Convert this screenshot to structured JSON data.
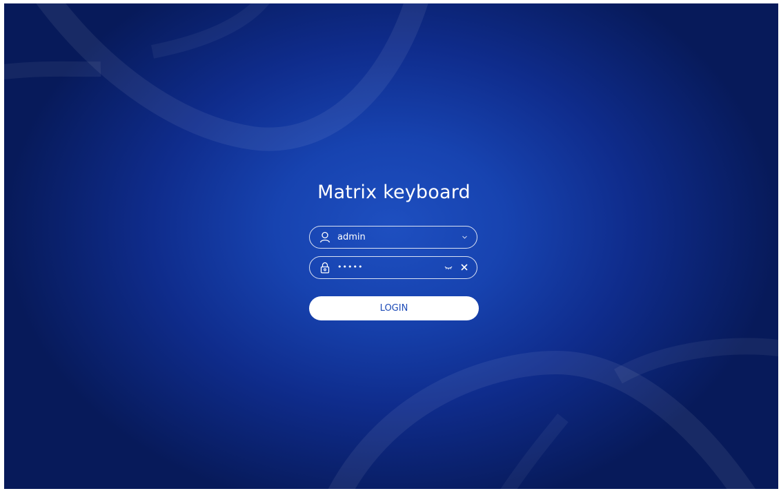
{
  "app": {
    "title": "Matrix keyboard"
  },
  "login": {
    "username": {
      "value": "admin",
      "icon": "user-icon",
      "trailing_icon": "chevron-down-icon"
    },
    "password": {
      "value": "•••••",
      "icon": "lock-icon",
      "trailing_icons": [
        "eye-closed-icon",
        "clear-icon"
      ]
    },
    "button_label": "LOGIN"
  },
  "colors": {
    "background_center": "#1e4fc0",
    "background_edge": "#071a5a",
    "foreground": "#ffffff",
    "button_text": "#1b49b6"
  }
}
